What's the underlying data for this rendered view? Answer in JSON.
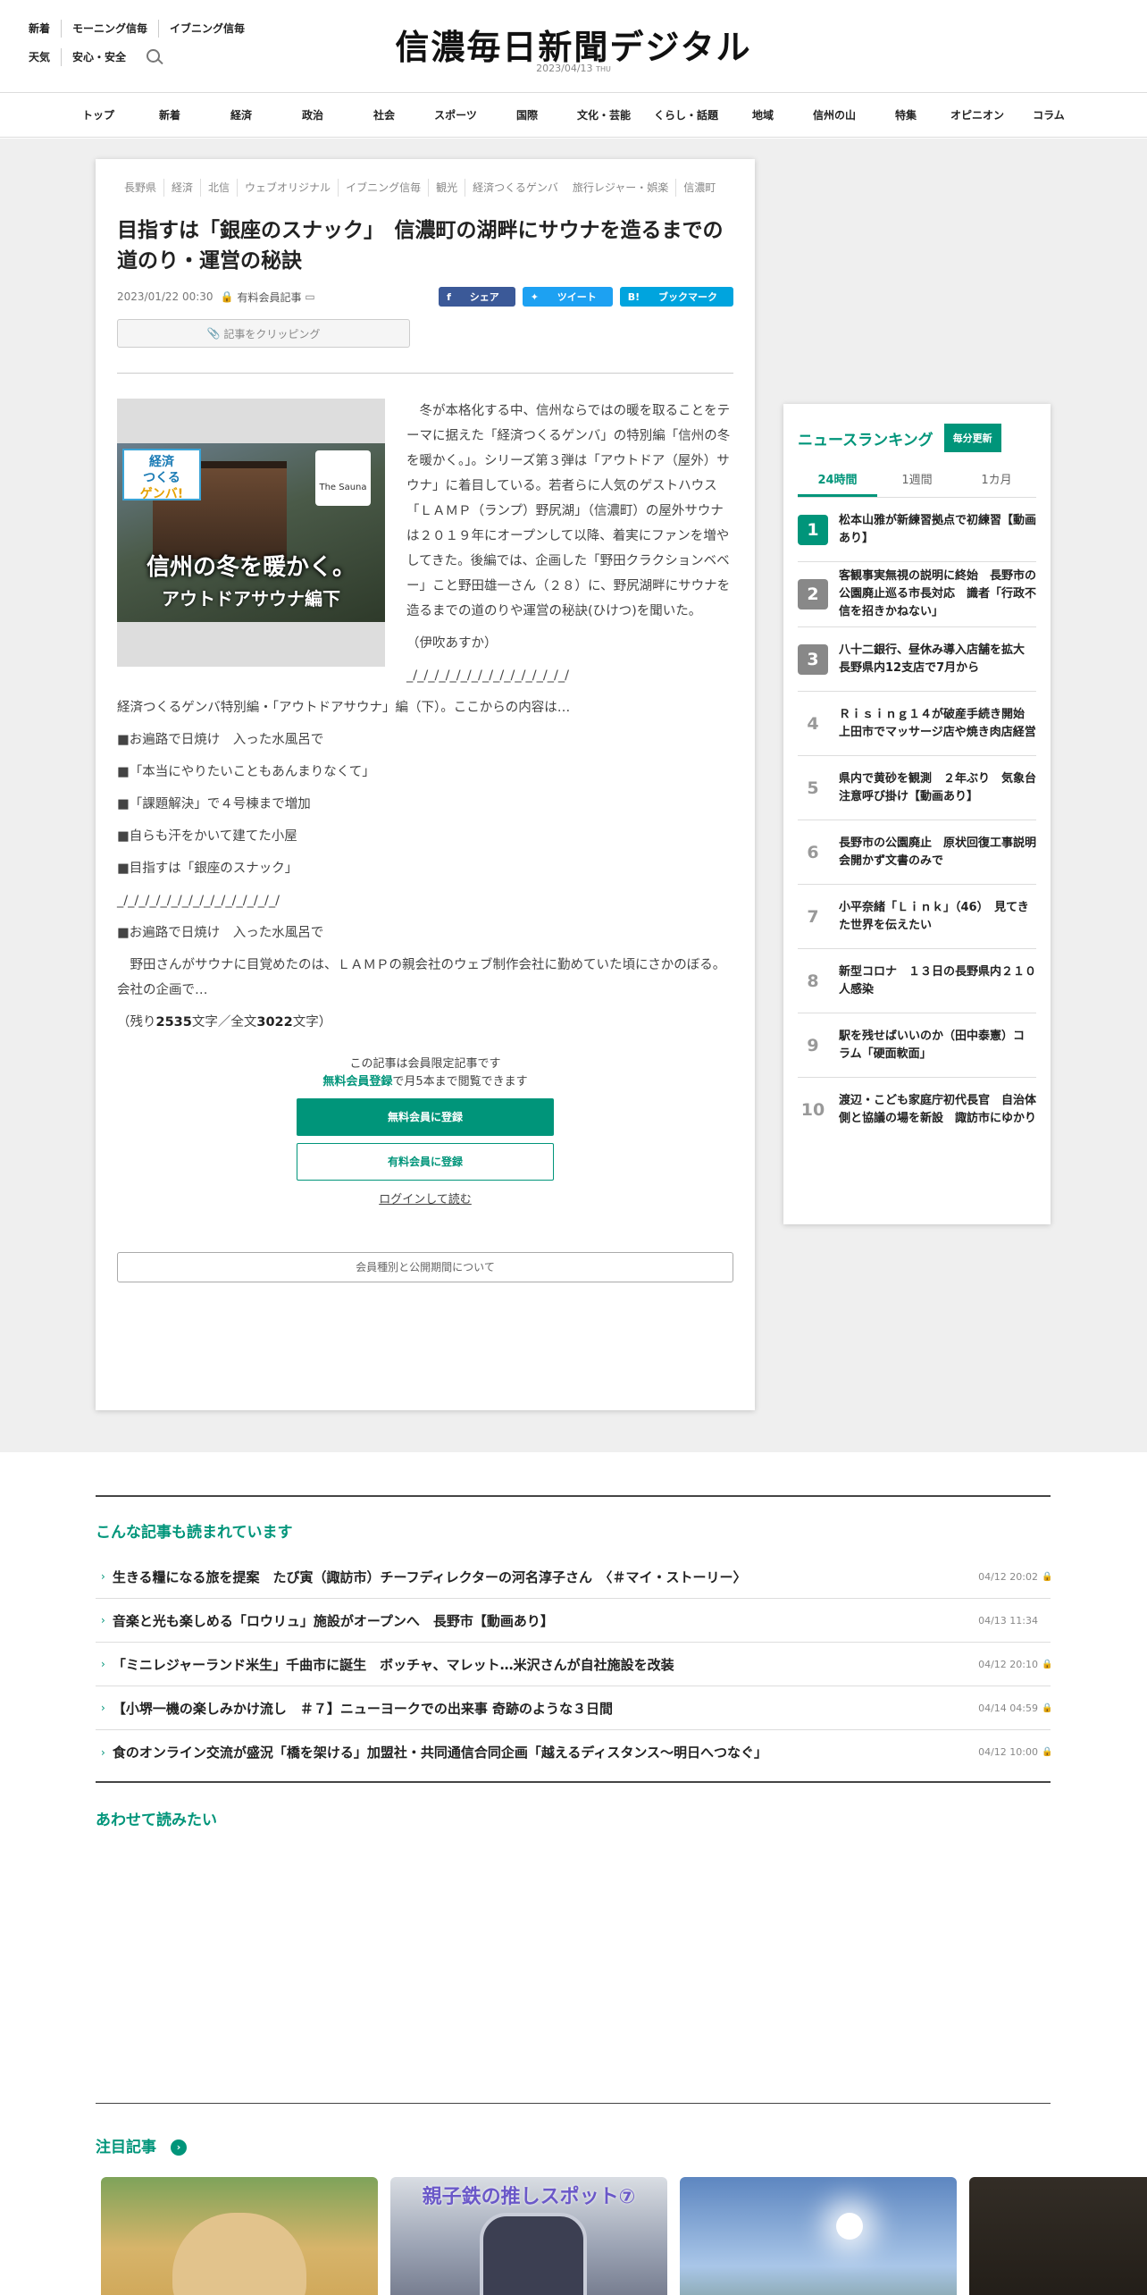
{
  "header": {
    "links_row1": [
      "新着",
      "モーニング信毎",
      "イブニング信毎"
    ],
    "links_row2": [
      "天気",
      "安心・安全"
    ],
    "logo": "信濃毎日新聞デジタル",
    "date": "2023/04/13",
    "weekday": "THU"
  },
  "nav": [
    "トップ",
    "新着",
    "経済",
    "政治",
    "社会",
    "スポーツ",
    "国際",
    "文化・芸能",
    "くらし・話題",
    "地域",
    "信州の山",
    "特集",
    "オピニオン",
    "コラム"
  ],
  "article": {
    "tags": [
      "長野県",
      "経済",
      "北信",
      "ウェブオリジナル",
      "イブニング信毎",
      "観光",
      "経済つくるゲンバ",
      "旅行レジャー・娯楽",
      "信濃町"
    ],
    "title": "目指すは「銀座のスナック」　信濃町の湖畔にサウナを造るまでの道のり・運営の秘訣",
    "datetime": "2023/01/22 00:30",
    "member_label": "有料会員記事",
    "share": {
      "facebook": "シェア",
      "twitter": "ツイート",
      "hatena": "ブックマーク"
    },
    "clip_label": "記事をクリッピング",
    "image": {
      "badge_line1": "経済",
      "badge_line2": "つくる",
      "badge_line3": "ゲンバ!",
      "logo_text": "The Sauna",
      "title": "信州の冬を暖かく。",
      "subtitle": "アウトドアサウナ編下"
    },
    "paragraphs": [
      "冬が本格化する中、信州ならではの暖を取ることをテーマに据えた「経済つくるゲンバ」の特別編「信州の冬を暖かく。」。シリーズ第３弾は「アウトドア（屋外）サウナ」に着目している。若者らに人気のゲストハウス「ＬＡＭＰ（ランプ）野尻湖」（信濃町）の屋外サウナは２０１９年にオープンして以降、着実にファンを増やしてきた。後編では、企画した「野田クラクションベベー」こと野田雄一さん（２８）に、野尻湖畔にサウナを造るまでの道のりや運営の秘訣(ひけつ)を聞いた。",
      "（伊吹あすか）",
      "_/_/_/_/_/_/_/_/_/_/_/_/_/_/_/",
      "経済つくるゲンバ特別編・「アウトドアサウナ」編（下）。ここからの内容は…",
      "■お遍路で日焼け　入った水風呂で",
      "■「本当にやりたいこともあんまりなくて」",
      "■「課題解決」で４号棟まで増加",
      "■自らも汗をかいて建てた小屋",
      "■目指すは「銀座のスナック」",
      "_/_/_/_/_/_/_/_/_/_/_/_/_/_/_/",
      "■お遍路で日焼け　入った水風呂で",
      "野田さんがサウナに目覚めたのは、ＬＡＭＰの親会社のウェブ制作会社に勤めていた頃にさかのぼる。会社の企画で…"
    ],
    "remaining_prefix": "（残り",
    "remaining_chars": "2535",
    "remaining_mid": "文字／全文",
    "total_chars": "3022",
    "remaining_suffix": "文字）",
    "paywall_line1": "この記事は会員限定記事です",
    "paywall_link": "無料会員登録",
    "paywall_line2": "で月5本まで閲覧できます",
    "btn_free": "無料会員に登録",
    "btn_paid": "有料会員に登録",
    "login": "ログインして読む",
    "about": "会員種別と公開期間について"
  },
  "ranking": {
    "title": "ニュースランキング",
    "badge": "毎分更新",
    "tabs": [
      "24時間",
      "1週間",
      "1カ月"
    ],
    "items": [
      {
        "rank": "1",
        "text": "松本山雅が新練習拠点で初練習【動画あり】"
      },
      {
        "rank": "2",
        "text": "客観事実無視の説明に終始　長野市の公園廃止巡る市長対応　識者「行政不信を招きかねない」"
      },
      {
        "rank": "3",
        "text": "八十二銀行、昼休み導入店舗を拡大　長野県内12支店で7月から"
      },
      {
        "rank": "4",
        "text": "Ｒｉｓｉｎｇ１４が破産手続き開始　上田市でマッサージ店や焼き肉店経営"
      },
      {
        "rank": "5",
        "text": "県内で黄砂を観測　２年ぶり　気象台注意呼び掛け【動画あり】"
      },
      {
        "rank": "6",
        "text": "長野市の公園廃止　原状回復工事説明会開かず文書のみで"
      },
      {
        "rank": "7",
        "text": "小平奈緒「Ｌｉｎｋ」（46）　見てきた世界を伝えたい"
      },
      {
        "rank": "8",
        "text": "新型コロナ　１３日の長野県内２１０人感染"
      },
      {
        "rank": "9",
        "text": "駅を残せばいいのか（田中泰憲）コラム「硬面軟面」"
      },
      {
        "rank": "10",
        "text": "渡辺・こども家庭庁初代長官　自治体側と協議の場を新設　諏訪市にゆかり"
      }
    ]
  },
  "related": {
    "title": "こんな記事も読まれています",
    "items": [
      {
        "text": "生きる糧になる旅を提案　たび寅（諏訪市）チーフディレクターの河名淳子さん　〈＃マイ・ストーリー〉",
        "date": "04/12 20:02",
        "locked": true
      },
      {
        "text": "音楽と光も楽しめる「ロウリュ」施設がオープンへ　長野市【動画あり】",
        "date": "04/13 11:34",
        "locked": false
      },
      {
        "text": "「ミニレジャーランド米生」千曲市に誕生　ボッチャ、マレット…米沢さんが自社施設を改装",
        "date": "04/12 20:10",
        "locked": true
      },
      {
        "text": "【小堺一機の楽しみかけ流し　＃７】ニューヨークでの出来事 奇跡のような３日間",
        "date": "04/14 04:59",
        "locked": true
      },
      {
        "text": "食のオンライン交流が盛況「橋を架ける」加盟社・共同通信合同企画「越えるディスタンス～明日へつなぐ」",
        "date": "04/12 10:00",
        "locked": true
      }
    ]
  },
  "also_read": {
    "title": "あわせて読みたい"
  },
  "featured": {
    "title": "注目記事",
    "card2_text": "親子鉄の推しスポット⑦"
  },
  "colors": {
    "accent": "#00957a",
    "lock": "#c9a227"
  }
}
